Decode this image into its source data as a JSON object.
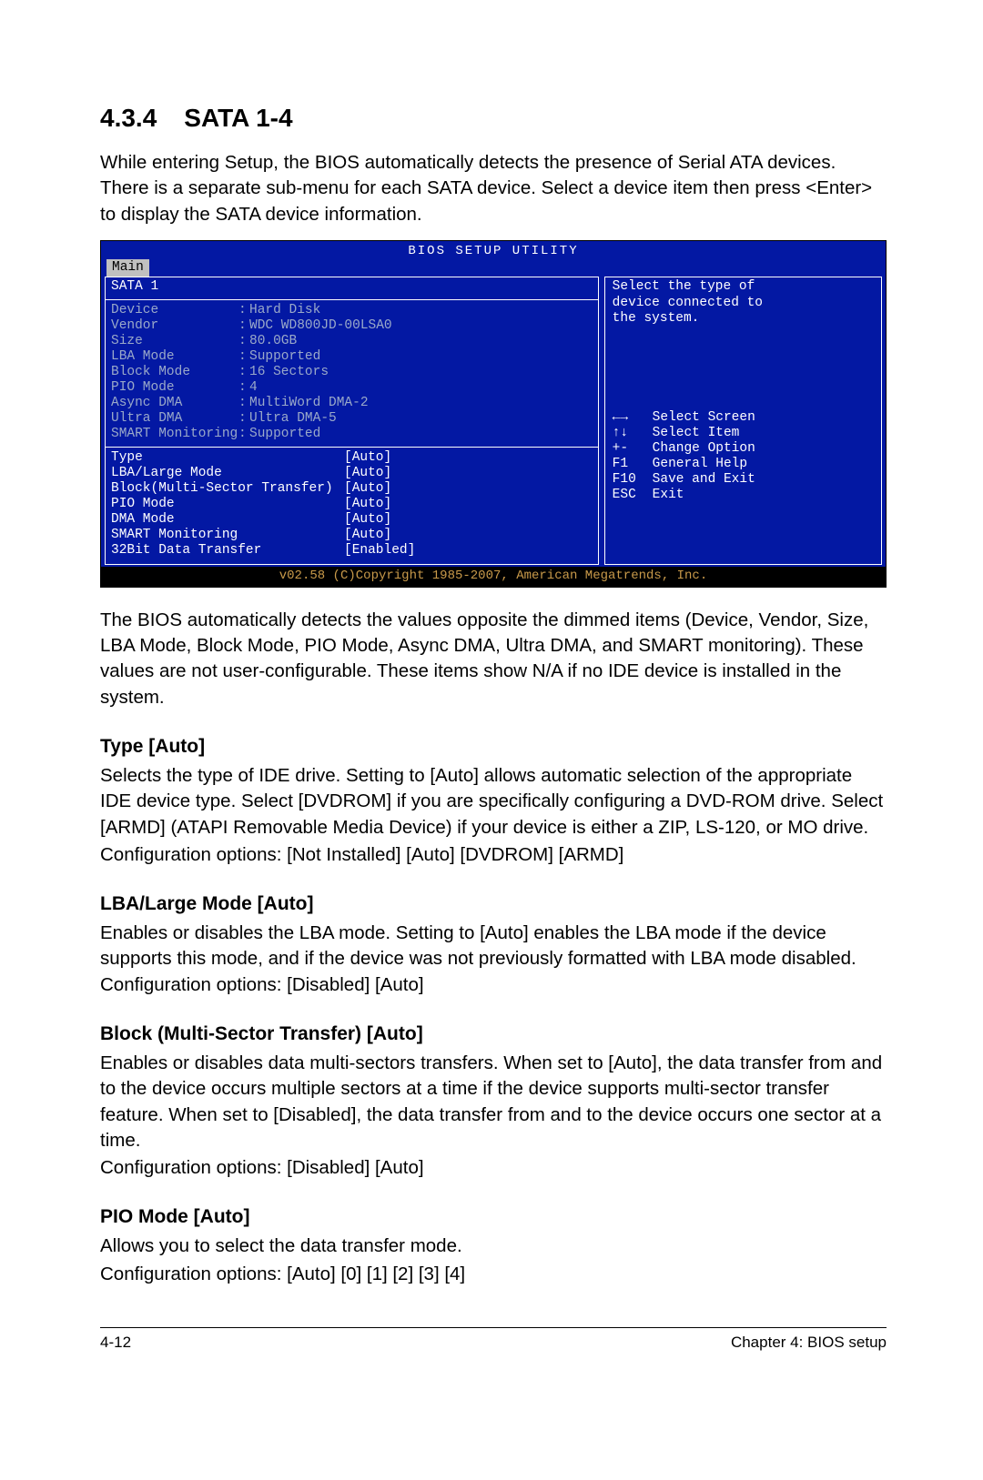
{
  "section": {
    "number": "4.3.4",
    "title": "SATA 1-4"
  },
  "intro": "While entering Setup, the BIOS automatically detects the presence of Serial ATA devices. There is a separate sub-menu for each SATA device. Select a device item then press <Enter> to display the SATA device information.",
  "bios": {
    "title": "BIOS SETUP UTILITY",
    "tab": "Main",
    "panel_title": "SATA 1",
    "info": [
      {
        "k": "Device",
        "v": "Hard Disk"
      },
      {
        "k": "Vendor",
        "v": "WDC WD800JD-00LSA0"
      },
      {
        "k": "Size",
        "v": "80.0GB"
      },
      {
        "k": "LBA Mode",
        "v": "Supported"
      },
      {
        "k": "Block Mode",
        "v": "16 Sectors"
      },
      {
        "k": "PIO Mode",
        "v": "4"
      },
      {
        "k": "Async DMA",
        "v": "MultiWord DMA-2"
      },
      {
        "k": "Ultra DMA",
        "v": "Ultra DMA-5"
      },
      {
        "k": "SMART Monitoring",
        "v": "Supported"
      }
    ],
    "options": [
      {
        "k": "Type",
        "v": "[Auto]"
      },
      {
        "k": "LBA/Large Mode",
        "v": "[Auto]"
      },
      {
        "k": "Block(Multi-Sector Transfer)",
        "v": "[Auto]"
      },
      {
        "k": "PIO Mode",
        "v": "[Auto]"
      },
      {
        "k": "DMA Mode",
        "v": "[Auto]"
      },
      {
        "k": "SMART Monitoring",
        "v": "[Auto]"
      },
      {
        "k": "32Bit Data Transfer",
        "v": "[Enabled]"
      }
    ],
    "help": "Select the type of\ndevice connected to\nthe system.",
    "nav": [
      {
        "icon": "←→",
        "label": "Select Screen"
      },
      {
        "icon": "↑↓",
        "label": "Select Item"
      },
      {
        "icon": "+-",
        "label": "Change Option"
      },
      {
        "icon": "F1",
        "label": "General Help"
      },
      {
        "icon": "F10",
        "label": "Save and Exit"
      },
      {
        "icon": "ESC",
        "label": "Exit"
      }
    ],
    "footer": "v02.58 (C)Copyright 1985-2007, American Megatrends, Inc."
  },
  "after_bios": "The BIOS automatically detects the values opposite the dimmed items (Device, Vendor, Size, LBA Mode, Block Mode, PIO Mode, Async DMA, Ultra DMA, and SMART monitoring). These values are not user-configurable. These items show N/A if no IDE device is installed in the system.",
  "subs": {
    "type": {
      "title": "Type [Auto]",
      "p1": "Selects the type of IDE drive. Setting to [Auto] allows automatic selection of the appropriate IDE device type. Select [DVDROM] if you are specifically configuring a DVD-ROM drive. Select [ARMD] (ATAPI Removable Media Device) if your device is either a ZIP, LS-120, or MO drive.",
      "p2": "Configuration options: [Not Installed] [Auto] [DVDROM] [ARMD]"
    },
    "lba": {
      "title": "LBA/Large Mode [Auto]",
      "p1": "Enables or disables the LBA mode. Setting to [Auto] enables the LBA mode if the device supports this mode, and if the device was not previously formatted with LBA mode disabled. Configuration options: [Disabled] [Auto]"
    },
    "block": {
      "title": "Block (Multi-Sector Transfer) [Auto]",
      "p1": "Enables or disables data multi-sectors transfers. When set to [Auto], the data transfer from and to the device occurs multiple sectors at a time if the device supports multi-sector transfer feature. When set to [Disabled], the data transfer from and to the device occurs one sector at a time.",
      "p2": "Configuration options: [Disabled] [Auto]"
    },
    "pio": {
      "title": "PIO Mode [Auto]",
      "p1": "Allows you to select the data transfer mode.",
      "p2": "Configuration options: [Auto] [0] [1] [2] [3] [4]"
    }
  },
  "footer": {
    "left": "4-12",
    "right": "Chapter 4: BIOS setup"
  }
}
